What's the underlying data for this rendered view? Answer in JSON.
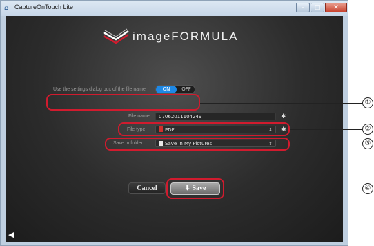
{
  "window": {
    "title": "CaptureOnTouch Lite"
  },
  "logo": {
    "text": "imageFORMULA"
  },
  "settings_dialog_row": {
    "label": "Use the settings dialog box of the file name",
    "toggle_on": "ON",
    "toggle_off": "OFF",
    "selected": "ON"
  },
  "file_name_row": {
    "label": "File name:",
    "value": "07062011104249"
  },
  "file_type_row": {
    "label": "File type:",
    "value": "PDF",
    "icon": "pdf-file-icon"
  },
  "save_folder_row": {
    "label": "Save in folder:",
    "value": "Save in My Pictures",
    "icon": "folder-icon"
  },
  "buttons": {
    "cancel": "Cancel",
    "save": "Save"
  },
  "callouts": {
    "labels": [
      "①",
      "②",
      "③",
      "④"
    ],
    "color": "#d11b2e"
  },
  "colors": {
    "accent": "#1e88e5",
    "background": "#2c2c2c"
  }
}
